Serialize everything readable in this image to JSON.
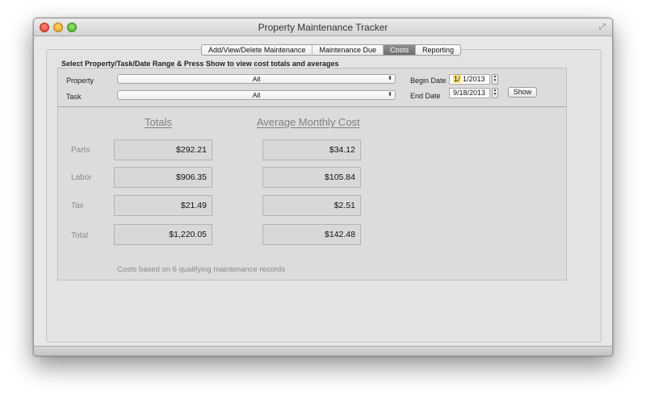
{
  "window": {
    "title": "Property Maintenance Tracker"
  },
  "tabs": [
    {
      "label": "Add/View/Delete Maintenance",
      "active": false
    },
    {
      "label": "Maintenance Due",
      "active": false
    },
    {
      "label": "Costs",
      "active": true
    },
    {
      "label": "Reporting",
      "active": false
    }
  ],
  "filters": {
    "instructions": "Select Property/Task/Date Range & Press Show to view cost totals and averages",
    "property_label": "Property",
    "property_value": "All",
    "task_label": "Task",
    "task_value": "All",
    "begin_label": "Begin Date",
    "begin_month": "1/",
    "begin_rest": " 1/2013",
    "end_label": "End Date",
    "end_value": "9/18/2013",
    "show_label": "Show"
  },
  "results": {
    "totals_header": "Totals",
    "average_header": "Average Monthly Cost",
    "rows": [
      {
        "label": "Parts",
        "total": "$292.21",
        "average": "$34.12"
      },
      {
        "label": "Labor",
        "total": "$906.35",
        "average": "$105.84"
      },
      {
        "label": "Tax",
        "total": "$21.49",
        "average": "$2.51"
      },
      {
        "label": "Total",
        "total": "$1,220.05",
        "average": "$142.48"
      }
    ],
    "footnote": "Costs based on 6 qualifying maintenance records"
  },
  "colors": {
    "active_tab": "#7a7a7a",
    "date_highlight": "#f7e27a"
  }
}
